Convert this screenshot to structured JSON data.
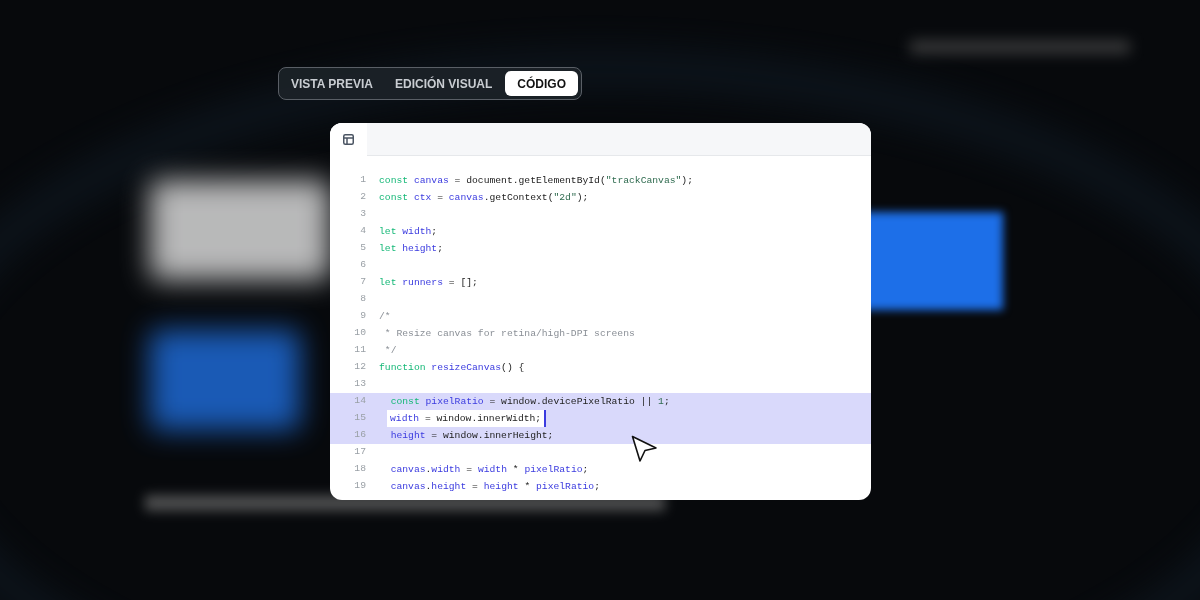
{
  "tabs": [
    {
      "label": "VISTA PREVIA",
      "selected": false
    },
    {
      "label": "EDICIÓN VISUAL",
      "selected": false
    },
    {
      "label": "CÓDIGO",
      "selected": true
    }
  ],
  "editor": {
    "lines": [
      {
        "number": "1",
        "highlighted": false,
        "tokens": [
          {
            "kind": "keyword",
            "text": "const "
          },
          {
            "kind": "name",
            "text": "canvas"
          },
          {
            "kind": "plain",
            "text": " = document.getElementById("
          },
          {
            "kind": "string",
            "text": "\"trackCanvas\""
          },
          {
            "kind": "plain",
            "text": ");"
          }
        ]
      },
      {
        "number": "2",
        "highlighted": false,
        "tokens": [
          {
            "kind": "keyword",
            "text": "const "
          },
          {
            "kind": "name",
            "text": "ctx"
          },
          {
            "kind": "plain",
            "text": " = "
          },
          {
            "kind": "name",
            "text": "canvas"
          },
          {
            "kind": "plain",
            "text": ".getContext("
          },
          {
            "kind": "string",
            "text": "\"2d\""
          },
          {
            "kind": "plain",
            "text": ");"
          }
        ]
      },
      {
        "number": "3",
        "highlighted": false
      },
      {
        "number": "4",
        "highlighted": false,
        "tokens": [
          {
            "kind": "keyword",
            "text": "let "
          },
          {
            "kind": "name",
            "text": "width"
          },
          {
            "kind": "plain",
            "text": ";"
          }
        ]
      },
      {
        "number": "5",
        "highlighted": false,
        "tokens": [
          {
            "kind": "keyword",
            "text": "let "
          },
          {
            "kind": "name",
            "text": "height"
          },
          {
            "kind": "plain",
            "text": ";"
          }
        ]
      },
      {
        "number": "6",
        "highlighted": false
      },
      {
        "number": "7",
        "highlighted": false,
        "tokens": [
          {
            "kind": "keyword",
            "text": "let "
          },
          {
            "kind": "name",
            "text": "runners"
          },
          {
            "kind": "plain",
            "text": " = [];"
          }
        ]
      },
      {
        "number": "8",
        "highlighted": false
      },
      {
        "number": "9",
        "highlighted": false,
        "tokens": [
          {
            "kind": "comment",
            "text": "/*"
          }
        ]
      },
      {
        "number": "10",
        "highlighted": false,
        "tokens": [
          {
            "kind": "comment",
            "text": " * Resize canvas for retina/high-DPI screens"
          }
        ]
      },
      {
        "number": "11",
        "highlighted": false,
        "tokens": [
          {
            "kind": "comment",
            "text": " */"
          }
        ]
      },
      {
        "number": "12",
        "highlighted": false,
        "tokens": [
          {
            "kind": "keyword",
            "text": "function "
          },
          {
            "kind": "name",
            "text": "resizeCanvas"
          },
          {
            "kind": "plain",
            "text": "() {"
          }
        ]
      },
      {
        "number": "13",
        "highlighted": false
      },
      {
        "number": "14",
        "highlighted": true,
        "tokens": [
          {
            "kind": "keyword",
            "text": "  const "
          },
          {
            "kind": "name",
            "text": "pixelRatio"
          },
          {
            "kind": "plain",
            "text": " = window.devicePixelRatio || "
          },
          {
            "kind": "number",
            "text": "1"
          },
          {
            "kind": "plain",
            "text": ";"
          }
        ]
      },
      {
        "number": "15",
        "highlighted": true,
        "editing": true,
        "tokens": [
          {
            "kind": "name",
            "text": "width"
          },
          {
            "kind": "plain",
            "text": " = window.innerWidth;"
          }
        ]
      },
      {
        "number": "16",
        "highlighted": true,
        "tokens": [
          {
            "kind": "name",
            "text": "  height"
          },
          {
            "kind": "plain",
            "text": " = window.innerHeight;"
          }
        ]
      },
      {
        "number": "17",
        "highlighted": false
      },
      {
        "number": "18",
        "highlighted": false,
        "tokens": [
          {
            "kind": "name",
            "text": "  canvas"
          },
          {
            "kind": "plain",
            "text": "."
          },
          {
            "kind": "name",
            "text": "width"
          },
          {
            "kind": "plain",
            "text": " = "
          },
          {
            "kind": "name",
            "text": "width"
          },
          {
            "kind": "plain",
            "text": " * "
          },
          {
            "kind": "name",
            "text": "pixelRatio"
          },
          {
            "kind": "plain",
            "text": ";"
          }
        ]
      },
      {
        "number": "19",
        "highlighted": false,
        "tokens": [
          {
            "kind": "name",
            "text": "  canvas"
          },
          {
            "kind": "plain",
            "text": "."
          },
          {
            "kind": "name",
            "text": "height"
          },
          {
            "kind": "plain",
            "text": " = "
          },
          {
            "kind": "name",
            "text": "height"
          },
          {
            "kind": "plain",
            "text": " * "
          },
          {
            "kind": "name",
            "text": "pixelRatio"
          },
          {
            "kind": "plain",
            "text": ";"
          }
        ]
      }
    ]
  }
}
